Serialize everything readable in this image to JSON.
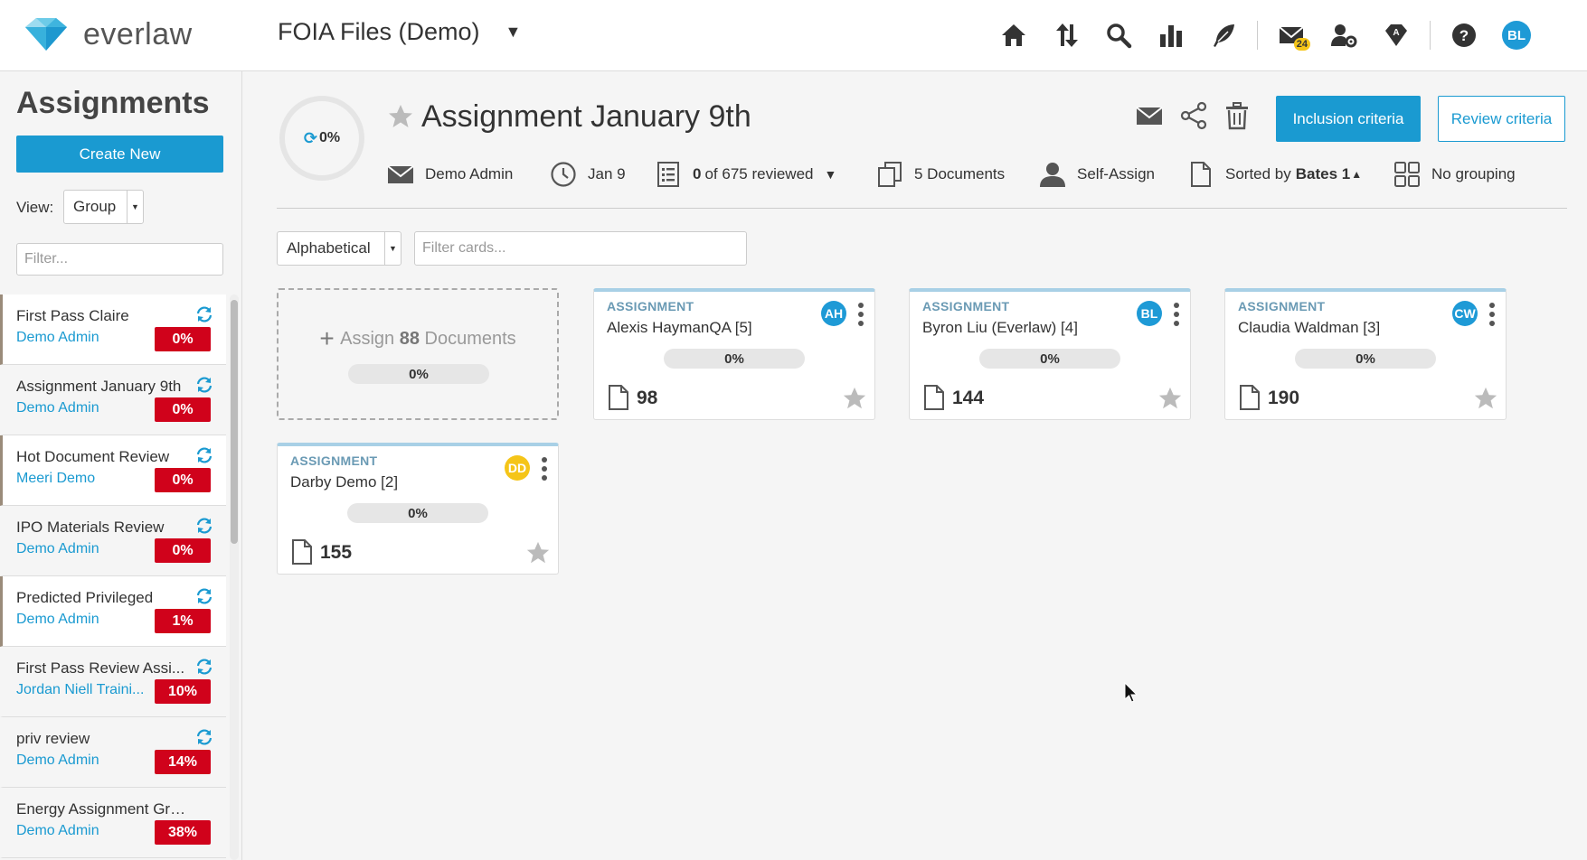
{
  "app": {
    "logo_text": "everlaw",
    "project_name": "FOIA Files (Demo)",
    "message_badge": "24",
    "user_initials": "BL",
    "nav_icons": [
      "home-icon",
      "upload-download-icon",
      "search-icon",
      "analytics-icon",
      "feather-icon",
      "messages-icon",
      "admin-settings-icon",
      "database-icon",
      "help-icon"
    ]
  },
  "sidebar": {
    "title": "Assignments",
    "create_label": "Create New",
    "view_label": "View:",
    "view_value": "Group",
    "filter_placeholder": "Filter...",
    "items": [
      {
        "name": "First Pass Claire",
        "owner": "Demo Admin",
        "progress": "0%"
      },
      {
        "name": "Assignment January 9th",
        "owner": "Demo Admin",
        "progress": "0%"
      },
      {
        "name": "Hot Document Review",
        "owner": "Meeri Demo",
        "progress": "0%"
      },
      {
        "name": "IPO Materials Review",
        "owner": "Demo Admin",
        "progress": "0%"
      },
      {
        "name": "Predicted Privileged",
        "owner": "Demo Admin",
        "progress": "1%"
      },
      {
        "name": "First Pass Review Assi...",
        "owner": "Jordan Niell Traini...",
        "progress": "10%"
      },
      {
        "name": "priv review",
        "owner": "Demo Admin",
        "progress": "14%"
      },
      {
        "name": "Energy Assignment Group",
        "owner": "Demo Admin",
        "progress": "38%"
      }
    ]
  },
  "header": {
    "progress": "0%",
    "title": "Assignment January 9th",
    "inclusion_label": "Inclusion criteria",
    "review_label": "Review criteria",
    "meta": {
      "owner": "Demo Admin",
      "date": "Jan 9",
      "reviewed_count": "0",
      "reviewed_rest": "of 675 reviewed",
      "documents": "5 Documents",
      "self_assign": "Self-Assign",
      "sorted_prefix": "Sorted by",
      "sorted_field": "Bates 1",
      "sorted_arrow": "▲",
      "grouping": "No grouping"
    }
  },
  "toolbar": {
    "sort_value": "Alphabetical",
    "filter_placeholder": "Filter cards..."
  },
  "unassigned": {
    "assign_prefix": "Assign",
    "assign_count": "88",
    "assign_suffix": "Documents",
    "progress": "0%"
  },
  "cards": [
    {
      "type": "ASSIGNMENT",
      "name": "Alexis HaymanQA [5]",
      "initials": "AH",
      "avatar_color": "#1e9ad6",
      "progress": "0%",
      "doc_count": "98"
    },
    {
      "type": "ASSIGNMENT",
      "name": "Byron Liu (Everlaw) [4]",
      "initials": "BL",
      "avatar_color": "#1e9ad6",
      "progress": "0%",
      "doc_count": "144"
    },
    {
      "type": "ASSIGNMENT",
      "name": "Claudia Waldman [3]",
      "initials": "CW",
      "avatar_color": "#1e9ad6",
      "progress": "0%",
      "doc_count": "190"
    },
    {
      "type": "ASSIGNMENT",
      "name": "Darby Demo [2]",
      "initials": "DD",
      "avatar_color": "#f5c518",
      "progress": "0%",
      "doc_count": "155"
    }
  ]
}
